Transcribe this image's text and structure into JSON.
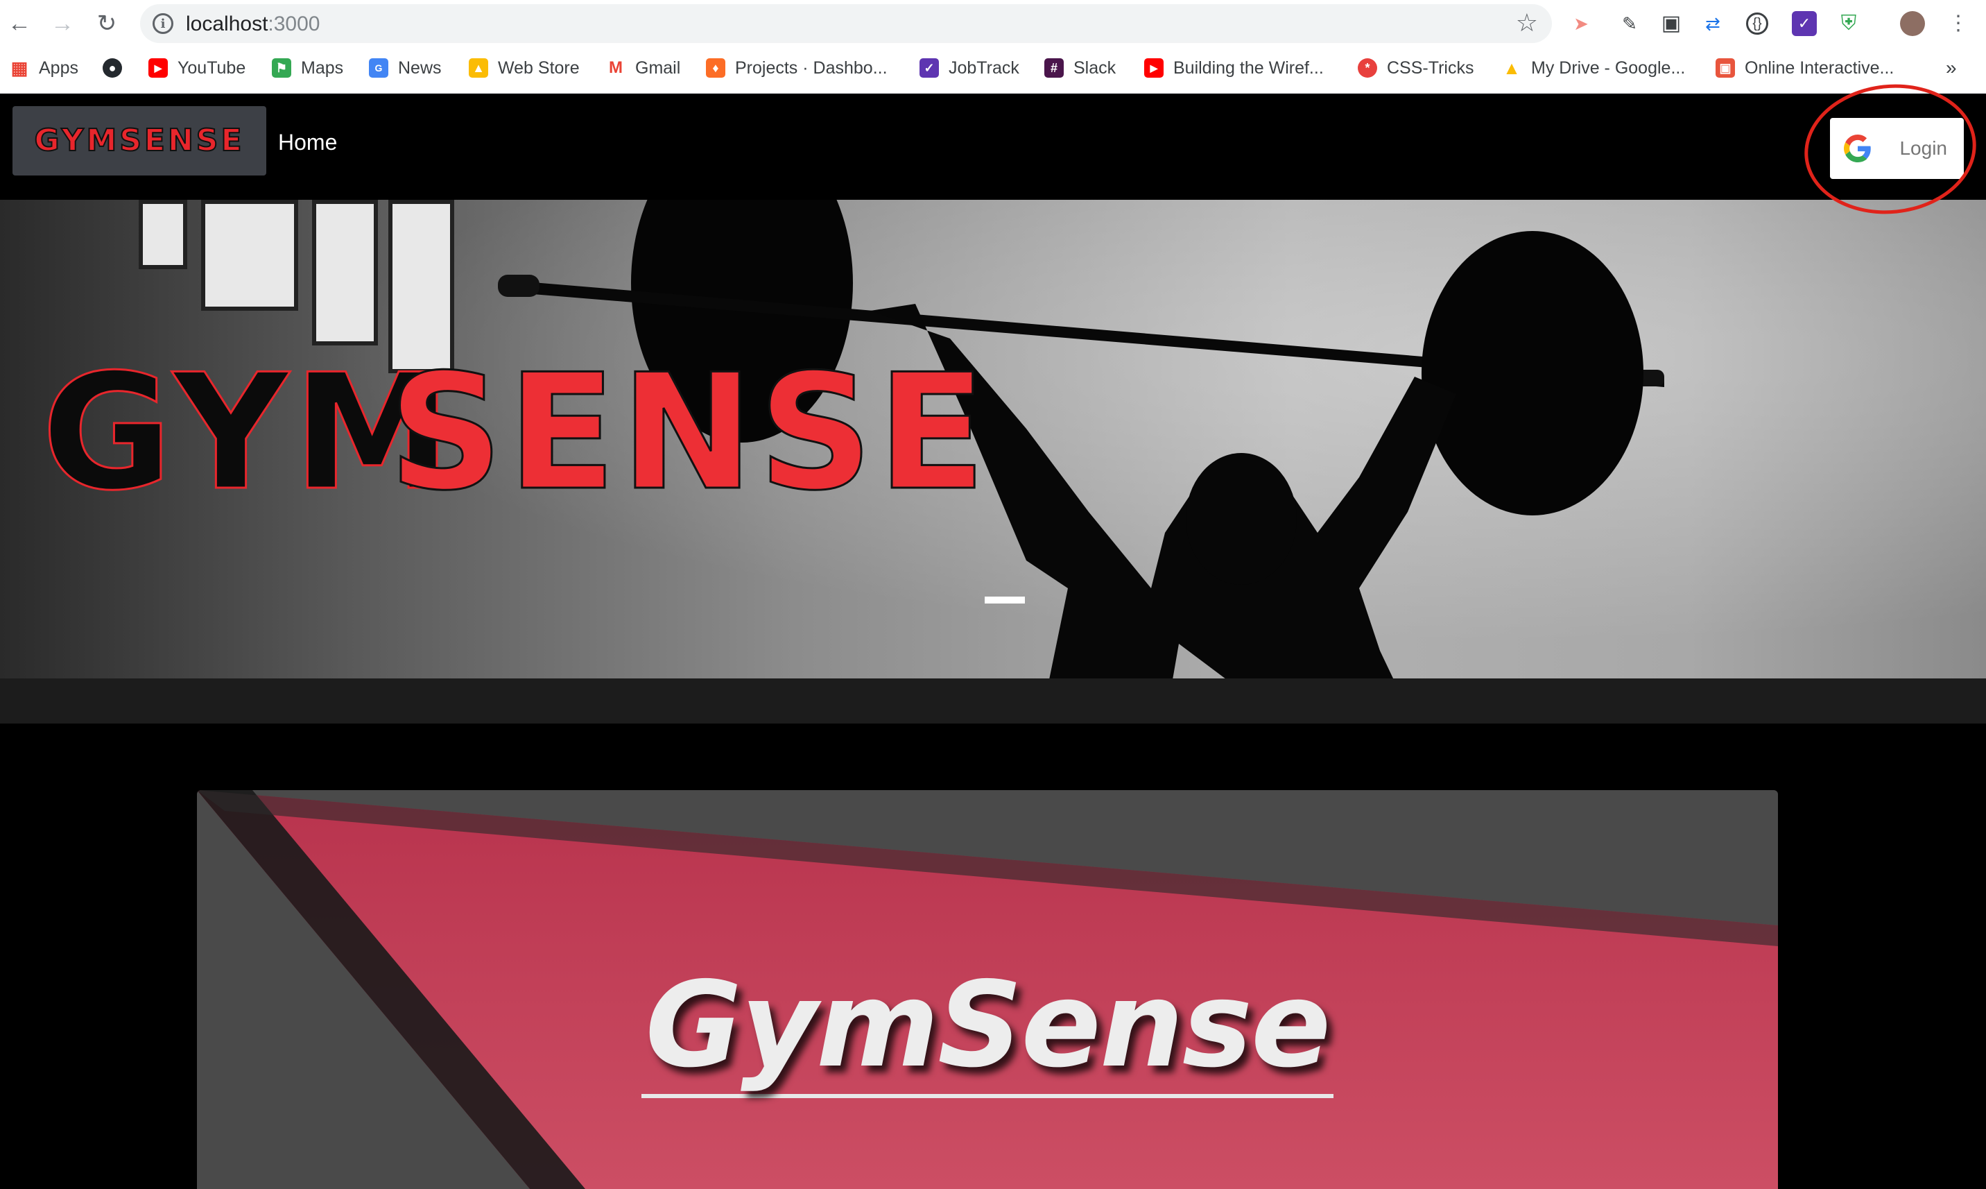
{
  "browser": {
    "url_host": "localhost",
    "url_port": ":3000",
    "bookmarks": [
      {
        "label": "Apps",
        "icon": "apps-grid-icon"
      },
      {
        "label": "",
        "icon": "github-icon"
      },
      {
        "label": "YouTube",
        "icon": "youtube-icon"
      },
      {
        "label": "Maps",
        "icon": "maps-icon"
      },
      {
        "label": "News",
        "icon": "news-icon"
      },
      {
        "label": "Web Store",
        "icon": "web-store-icon"
      },
      {
        "label": "Gmail",
        "icon": "gmail-icon"
      },
      {
        "label": "Projects · Dashbo...",
        "icon": "gitlab-icon"
      },
      {
        "label": "JobTrack",
        "icon": "jobtrack-icon"
      },
      {
        "label": "Slack",
        "icon": "slack-icon"
      },
      {
        "label": "Building the Wiref...",
        "icon": "youtube-icon"
      },
      {
        "label": "CSS-Tricks",
        "icon": "css-tricks-icon"
      },
      {
        "label": "My Drive - Google...",
        "icon": "google-drive-icon"
      },
      {
        "label": "Online Interactive...",
        "icon": "codepen-icon"
      }
    ],
    "overflow_label": "»"
  },
  "navbar": {
    "brand_logo_text": "GYMSENSE",
    "home_label": "Home",
    "login_label": "Login"
  },
  "hero": {
    "logo_text_dark": "GYM",
    "logo_text_red": "SENSE"
  },
  "card": {
    "title": "GymSense"
  },
  "colors": {
    "brand_red": "#e8262c",
    "card_pink": "#c8455c",
    "annotation_red": "#e0231a"
  }
}
